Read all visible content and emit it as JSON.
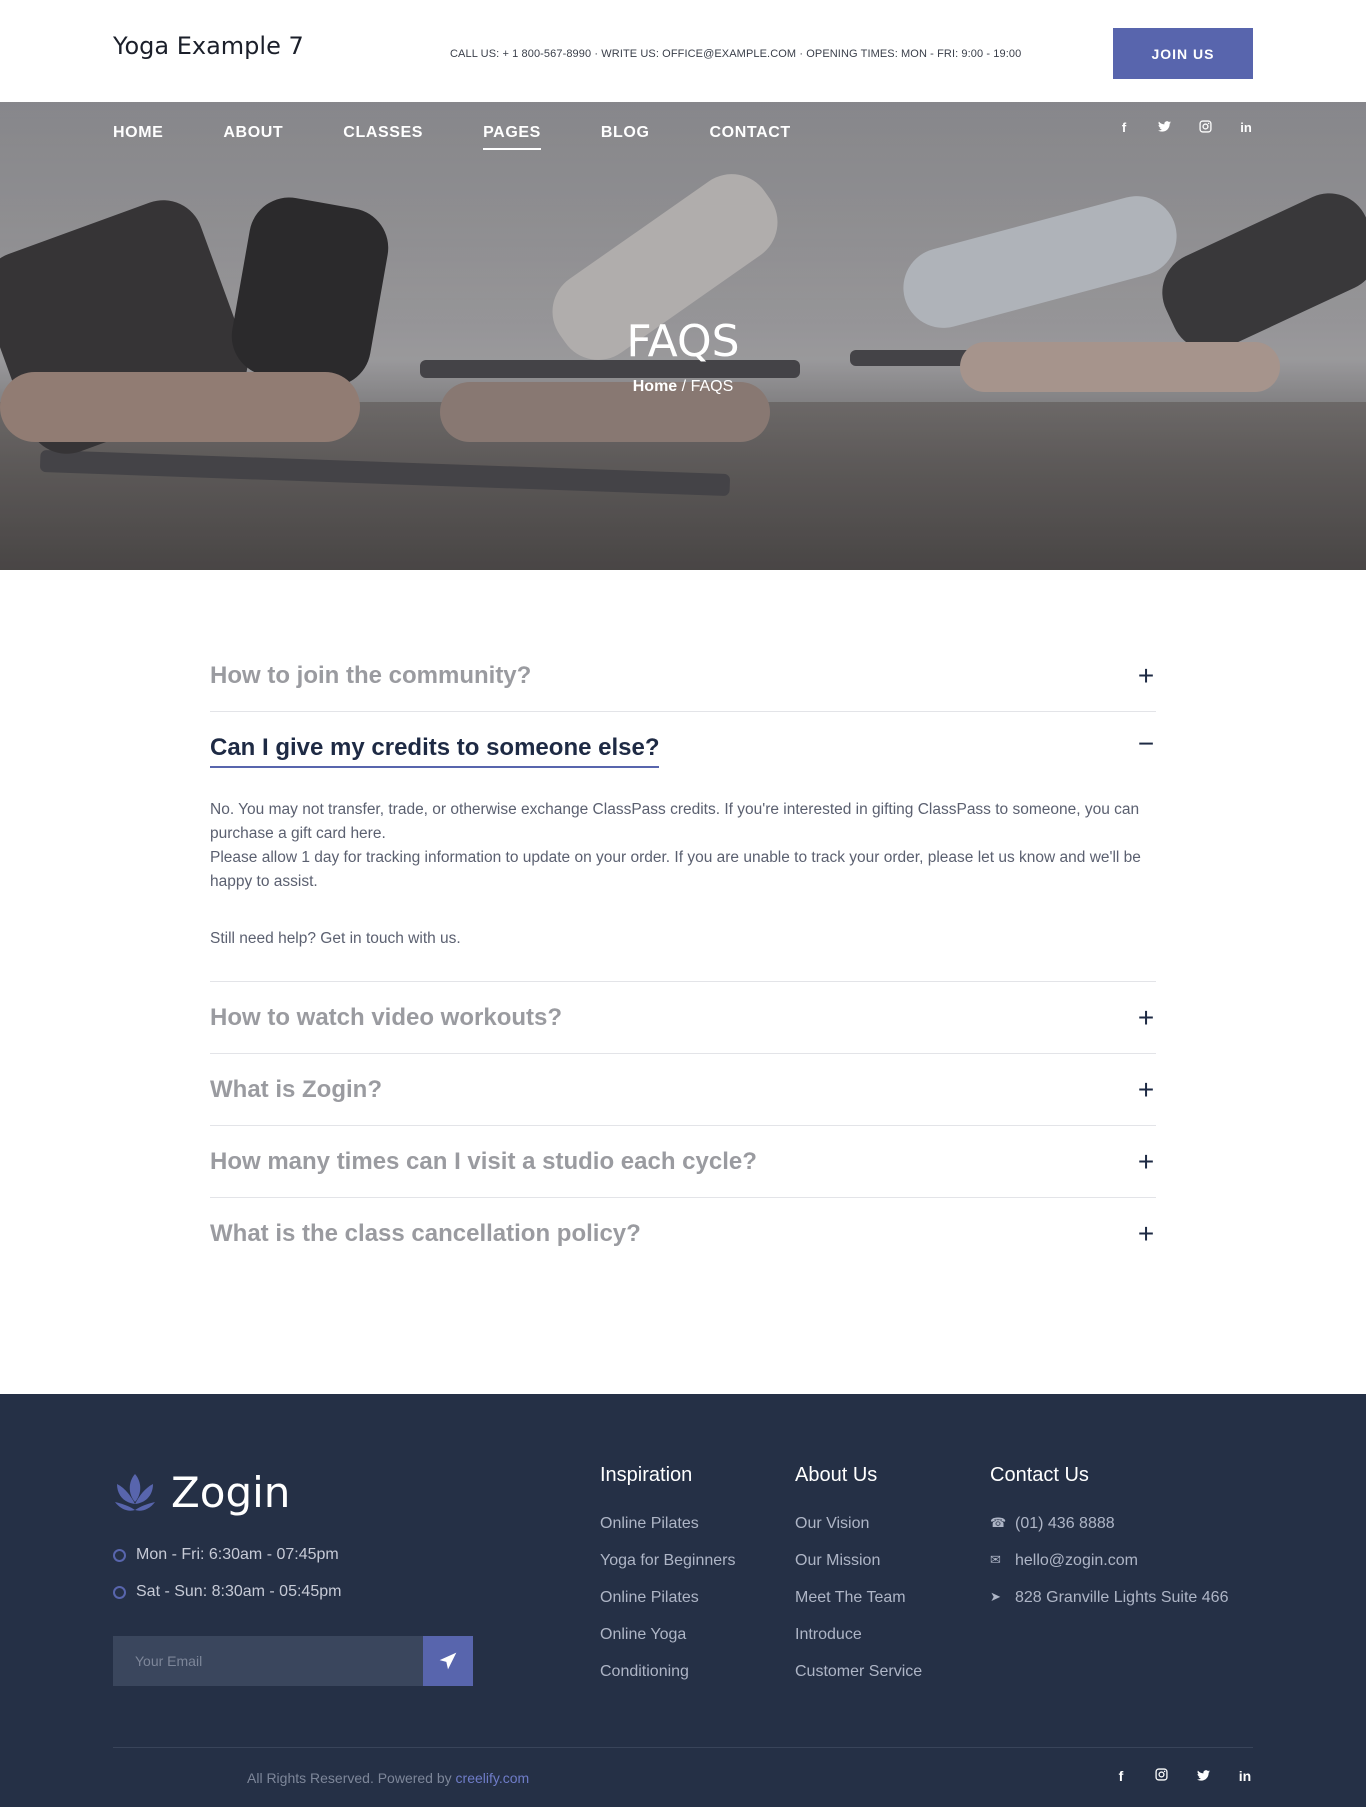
{
  "header": {
    "logo": "Yoga Example 7",
    "contact_line": "CALL US: + 1 800-567-8990 · WRITE US: OFFICE@EXAMPLE.COM · OPENING TIMES: MON - FRI: 9:00 - 19:00",
    "join_label": "JOIN US"
  },
  "nav": {
    "items": [
      "HOME",
      "ABOUT",
      "CLASSES",
      "PAGES",
      "BLOG",
      "CONTACT"
    ],
    "active": "PAGES"
  },
  "social": {
    "icons": [
      "facebook-icon",
      "twitter-icon",
      "instagram-icon",
      "linkedin-icon"
    ]
  },
  "hero": {
    "title": "FAQS",
    "breadcrumb_home": "Home",
    "breadcrumb_sep": "/",
    "breadcrumb_current": "FAQS"
  },
  "faq": {
    "items": [
      {
        "question": "How to join the community?",
        "toggle": "+"
      },
      {
        "question": "Can I give my credits to someone else?",
        "toggle": "−",
        "answer_1": "No. You may not transfer, trade, or otherwise exchange ClassPass credits. If you're interested in gifting ClassPass to someone, you can purchase a gift card here.",
        "answer_2": "Please allow 1 day for tracking information to update on your order. If you are unable to track your order, please let us know and we'll be happy to assist.",
        "answer_3": "Still need help? Get in touch with us."
      },
      {
        "question": "How to watch video workouts?",
        "toggle": "+"
      },
      {
        "question": "What is Zogin?",
        "toggle": "+"
      },
      {
        "question": "How many times can I visit a studio each cycle?",
        "toggle": "+"
      },
      {
        "question": "What is the class cancellation policy?",
        "toggle": "+"
      }
    ]
  },
  "footer": {
    "brand": "Zogin",
    "hours": [
      "Mon - Fri: 6:30am - 07:45pm",
      "Sat - Sun: 8:30am - 05:45pm"
    ],
    "email_placeholder": "Your Email",
    "columns": [
      {
        "title": "Inspiration",
        "links": [
          "Online Pilates",
          "Yoga for Beginners",
          "Online Pilates",
          "Online Yoga",
          "Conditioning"
        ]
      },
      {
        "title": "About Us",
        "links": [
          "Our Vision",
          "Our Mission",
          "Meet The Team",
          "Introduce",
          "Customer Service"
        ]
      }
    ],
    "contact": {
      "title": "Contact Us",
      "phone": "(01) 436 8888",
      "email": "hello@zogin.com",
      "address": "828 Granville Lights Suite 466"
    },
    "copyright_text": "All Rights Reserved. Powered by",
    "copyright_link": "creelify.com",
    "social_icons": [
      "facebook-icon",
      "instagram-icon",
      "twitter-icon",
      "linkedin-icon"
    ]
  },
  "colors": {
    "accent": "#5865ad",
    "footer_bg": "#253046",
    "heading": "#1e2a44"
  }
}
